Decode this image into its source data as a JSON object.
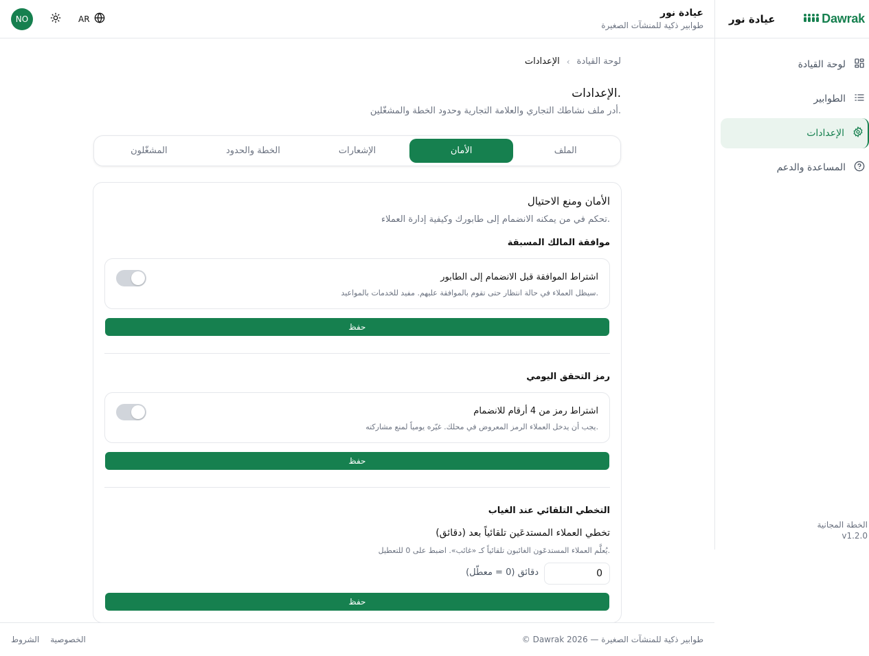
{
  "app": {
    "brand_logo_text": "Dawrak",
    "business_name": "عيادة نور",
    "business_tagline": "طوابير ذكية للمنشآت الصغيرة",
    "brand_color": "#16804f"
  },
  "header": {
    "avatar_initials": "NO",
    "lang_label": "AR"
  },
  "sidebar": {
    "items": [
      {
        "label": "لوحة القيادة",
        "icon": "dashboard-grid-icon",
        "active": false
      },
      {
        "label": "الطوابير",
        "icon": "list-icon",
        "active": false
      },
      {
        "label": "الإعدادات",
        "icon": "gear-icon",
        "active": true
      },
      {
        "label": "المساعدة والدعم",
        "icon": "help-circle-icon",
        "active": false
      }
    ],
    "plan_label": "الخطة المجانية",
    "version": "v1.2.0"
  },
  "breadcrumb": {
    "parent": "لوحة القيادة",
    "separator": "›",
    "current": "الإعدادات"
  },
  "page": {
    "title": "الإعدادات.",
    "subtitle": "أدر ملف نشاطك التجاري والعلامة التجارية وحدود الخطة والمشغّلين."
  },
  "tabs": [
    {
      "label": "الملف",
      "active": false
    },
    {
      "label": "الأمان",
      "active": true
    },
    {
      "label": "الإشعارات",
      "active": false
    },
    {
      "label": "الخطة والحدود",
      "active": false
    },
    {
      "label": "المشغّلون",
      "active": false
    }
  ],
  "security": {
    "title": "الأمان ومنع الاحتيال",
    "description": "تحكم في من يمكنه الانضمام إلى طابورك وكيفية إدارة العملاء.",
    "approval": {
      "section_title": "موافقة المالك المسبقة",
      "toggle_label": "اشتراط الموافقة قبل الانضمام إلى الطابور",
      "toggle_hint": "سيظل العملاء في حالة انتظار حتى تقوم بالموافقة عليهم. مفيد للخدمات بالمواعيد.",
      "enabled": false,
      "save_label": "حفظ"
    },
    "daily_code": {
      "section_title": "رمز التحقق اليومي",
      "toggle_label": "اشتراط رمز من 4 أرقام للانضمام",
      "toggle_hint": "يجب أن يدخل العملاء الرمز المعروض في محلك. غيّره يومياً لمنع مشاركته.",
      "enabled": false,
      "save_label": "حفظ"
    },
    "auto_skip": {
      "section_title": "التخطي التلقائي عند الغياب",
      "field_label": "تخطي العملاء المستدعَين تلقائياً بعد (دقائق)",
      "field_hint": "يُعلَّم العملاء المستدعَون الغائبون تلقائياً كـ «غائب». اضبط على 0 للتعطيل.",
      "value": "0",
      "unit_label": "دقائق (0 = معطّل)",
      "save_label": "حفظ"
    }
  },
  "footer": {
    "copyright": "© Dawrak 2026 — طوابير ذكية للمنشآت الصغيرة",
    "privacy": "الخصوصية",
    "terms": "الشروط"
  }
}
